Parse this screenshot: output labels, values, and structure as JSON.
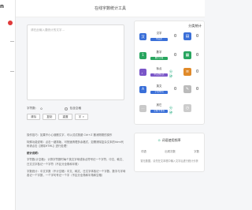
{
  "sidebar": {
    "logo_text": "n"
  },
  "header": {
    "title": "在线字数统计工具"
  },
  "editor": {
    "placeholder": "请在此输入要统计的文字..."
  },
  "stats_line": {
    "label": "字符数：",
    "value": "0",
    "checkbox_label": "包含空格"
  },
  "buttons": {
    "copy": "清除",
    "sample": "复制",
    "clear": "重置",
    "select": "字"
  },
  "description": {
    "p1": "操作技巧：如果不小心误删文字，可以试试按键 Ctrl+Z 撤消刚刚的操作",
    "p2": "特殊功能说明：点击一键排版，可快速清理多余格式，如需清除复杂文本的html代码请点击【清除HTML】进行处理！",
    "p3_title": "统计说明：",
    "p3": "字符数(计空格)：计算字符数时每个英文字母或标点符号记一个字符，中文、韩文、日文汉字各记一个字符（不区分全角和半角）",
    "p4": "字数统计：中文字数（不计空格）中文、韩文、日文字体各记一个字数，数字与字母各记一个字数，一个字句号记一个字（不区分全角和半角和空格）"
  },
  "stats_panel": {
    "title": "分类统计",
    "categories": [
      {
        "label": "汉字",
        "sub": "中英文",
        "value": "0",
        "color": "#3a6fd8",
        "icon": "汉"
      },
      {
        "label": "数字",
        "sub": "数字之和",
        "value": "0",
        "color": "#28a55f",
        "icon": "1"
      },
      {
        "label": "标点",
        "sub": "中英文标点",
        "value": "0",
        "color": "#7a56c8",
        "icon": "，"
      },
      {
        "label": "英文",
        "sub": "字母/单词",
        "value": "0",
        "color": "#3a6fd8",
        "icon": "A"
      },
      {
        "label": "其它",
        "sub": "全角/半角等",
        "value": "分钟",
        "color": "#c9c9c9",
        "icon": "…"
      }
    ],
    "side_values": [
      "0",
      "0",
      "0",
      "0",
      "分钟"
    ]
  },
  "freq_panel": {
    "title": "词语使用频率",
    "columns": [
      "词语",
      "出现次数",
      "字数"
    ],
    "empty_text": "暂无数据，请先在文本框中输入文字后进行统计分析"
  }
}
